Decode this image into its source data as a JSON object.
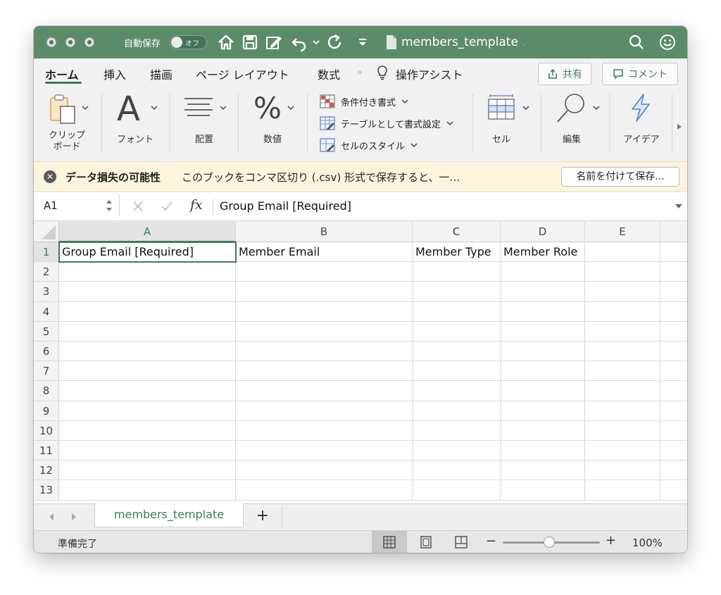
{
  "titlebar": {
    "autosave_label": "自動保存",
    "autosave_state": "オフ",
    "document_title": "members_template"
  },
  "tabs": [
    "ホーム",
    "挿入",
    "描画",
    "ページ レイアウト",
    "数式"
  ],
  "tell_me": "操作アシスト",
  "share_label": "共有",
  "comment_label": "コメント",
  "ribbon": {
    "clipboard": "クリップ\nボード",
    "font": "フォント",
    "align": "配置",
    "number": "数値",
    "conditional": "条件付き書式",
    "table_format": "テーブルとして書式設定",
    "cell_style": "セルのスタイル",
    "cells": "セル",
    "editing": "編集",
    "ideas": "アイデア"
  },
  "warning": {
    "title": "データ損失の可能性",
    "message": "このブックをコンマ区切り (.csv) 形式で保存すると、一…",
    "button": "名前を付けて保存..."
  },
  "formula_bar": {
    "cell_ref": "A1",
    "fx": "fx",
    "content": "Group Email [Required]"
  },
  "grid": {
    "columns": [
      "A",
      "B",
      "C",
      "D",
      "E"
    ],
    "rows": [
      "1",
      "2",
      "3",
      "4",
      "5",
      "6",
      "7",
      "8",
      "9",
      "10",
      "11",
      "12",
      "13"
    ],
    "row1": [
      "Group Email [Required]",
      "Member Email",
      "Member Type",
      "Member Role",
      ""
    ]
  },
  "sheet_tab": "members_template",
  "status": {
    "ready": "準備完了",
    "zoom": "100%"
  },
  "colors": {
    "accent": "#5b8c6a",
    "accent_dark": "#3e7d55",
    "warning_bg": "#fcf4dd"
  }
}
